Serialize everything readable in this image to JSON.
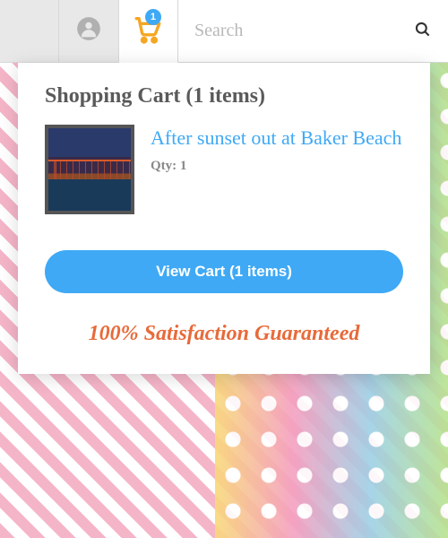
{
  "header": {
    "cart_badge": "1",
    "search_placeholder": "Search"
  },
  "dropdown": {
    "title": "Shopping Cart (1 items)",
    "item": {
      "name": "After sunset out at Baker Beach",
      "qty_label": "Qty: 1"
    },
    "view_cart_label": "View Cart (1 items)",
    "guarantee": "100% Satisfaction Guaranteed"
  }
}
